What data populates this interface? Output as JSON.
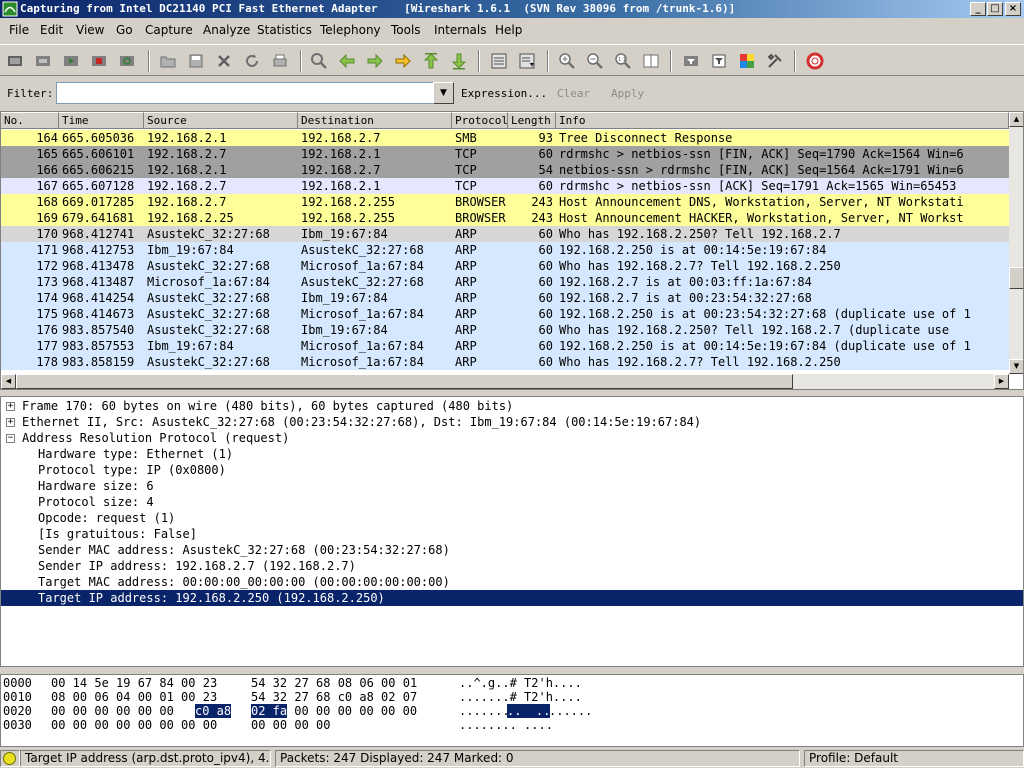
{
  "window": {
    "title": "Capturing from Intel DC21140 PCI Fast Ethernet Adapter    [Wireshark 1.6.1  (SVN Rev 38096 from /trunk-1.6)]",
    "minimize": "_",
    "maximize": "□",
    "close": "×"
  },
  "menu": [
    "File",
    "Edit",
    "View",
    "Go",
    "Capture",
    "Analyze",
    "Statistics",
    "Telephony",
    "Tools",
    "Internals",
    "Help"
  ],
  "filter": {
    "label": "Filter:",
    "value": "",
    "expression": "Expression...",
    "clear": "Clear",
    "apply": "Apply"
  },
  "columns": [
    "No.",
    "Time",
    "Source",
    "Destination",
    "Protocol",
    "Length",
    "Info"
  ],
  "packets": [
    {
      "no": "164",
      "time": "665.605036",
      "src": "192.168.2.1",
      "dst": "192.168.2.7",
      "proto": "SMB",
      "len": "93",
      "info": "Tree Disconnect Response",
      "bg": "#ffff99",
      "fg": "#000000"
    },
    {
      "no": "165",
      "time": "665.606101",
      "src": "192.168.2.7",
      "dst": "192.168.2.1",
      "proto": "TCP",
      "len": "60",
      "info": "rdrmshc > netbios-ssn [FIN, ACK] Seq=1790 Ack=1564 Win=6",
      "bg": "#a0a0a0",
      "fg": "#000000"
    },
    {
      "no": "166",
      "time": "665.606215",
      "src": "192.168.2.1",
      "dst": "192.168.2.7",
      "proto": "TCP",
      "len": "54",
      "info": "netbios-ssn > rdrmshc [FIN, ACK] Seq=1564 Ack=1791 Win=6",
      "bg": "#a0a0a0",
      "fg": "#000000"
    },
    {
      "no": "167",
      "time": "665.607128",
      "src": "192.168.2.7",
      "dst": "192.168.2.1",
      "proto": "TCP",
      "len": "60",
      "info": "rdrmshc > netbios-ssn [ACK] Seq=1791 Ack=1565 Win=65453",
      "bg": "#e7e6ff",
      "fg": "#000000"
    },
    {
      "no": "168",
      "time": "669.017285",
      "src": "192.168.2.7",
      "dst": "192.168.2.255",
      "proto": "BROWSER",
      "len": "243",
      "info": "Host Announcement DNS, Workstation, Server, NT Workstati",
      "bg": "#ffff99",
      "fg": "#000000"
    },
    {
      "no": "169",
      "time": "679.641681",
      "src": "192.168.2.25",
      "dst": "192.168.2.255",
      "proto": "BROWSER",
      "len": "243",
      "info": "Host Announcement HACKER, Workstation, Server, NT Workst",
      "bg": "#ffff99",
      "fg": "#000000"
    },
    {
      "no": "170",
      "time": "968.412741",
      "src": "AsustekC_32:27:68",
      "dst": "Ibm_19:67:84",
      "proto": "ARP",
      "len": "60",
      "info": "Who has 192.168.2.250?  Tell 192.168.2.7",
      "bg": "#d6d6d6",
      "fg": "#000000"
    },
    {
      "no": "171",
      "time": "968.412753",
      "src": "Ibm_19:67:84",
      "dst": "AsustekC_32:27:68",
      "proto": "ARP",
      "len": "60",
      "info": "192.168.2.250 is at 00:14:5e:19:67:84",
      "bg": "#d6e8ff",
      "fg": "#000000"
    },
    {
      "no": "172",
      "time": "968.413478",
      "src": "AsustekC_32:27:68",
      "dst": "Microsof_1a:67:84",
      "proto": "ARP",
      "len": "60",
      "info": "Who has 192.168.2.7?  Tell 192.168.2.250",
      "bg": "#d6e8ff",
      "fg": "#000000"
    },
    {
      "no": "173",
      "time": "968.413487",
      "src": "Microsof_1a:67:84",
      "dst": "AsustekC_32:27:68",
      "proto": "ARP",
      "len": "60",
      "info": "192.168.2.7 is at 00:03:ff:1a:67:84",
      "bg": "#d6e8ff",
      "fg": "#000000"
    },
    {
      "no": "174",
      "time": "968.414254",
      "src": "AsustekC_32:27:68",
      "dst": "Ibm_19:67:84",
      "proto": "ARP",
      "len": "60",
      "info": "192.168.2.7 is at 00:23:54:32:27:68",
      "bg": "#d6e8ff",
      "fg": "#000000"
    },
    {
      "no": "175",
      "time": "968.414673",
      "src": "AsustekC_32:27:68",
      "dst": "Microsof_1a:67:84",
      "proto": "ARP",
      "len": "60",
      "info": "192.168.2.250 is at 00:23:54:32:27:68 (duplicate use of 1",
      "bg": "#d6e8ff",
      "fg": "#000000"
    },
    {
      "no": "176",
      "time": "983.857540",
      "src": "AsustekC_32:27:68",
      "dst": "Ibm_19:67:84",
      "proto": "ARP",
      "len": "60",
      "info": "Who has 192.168.2.250?  Tell 192.168.2.7 (duplicate use",
      "bg": "#d6e8ff",
      "fg": "#000000"
    },
    {
      "no": "177",
      "time": "983.857553",
      "src": "Ibm_19:67:84",
      "dst": "Microsof_1a:67:84",
      "proto": "ARP",
      "len": "60",
      "info": "192.168.2.250 is at 00:14:5e:19:67:84 (duplicate use of 1",
      "bg": "#d6e8ff",
      "fg": "#000000"
    },
    {
      "no": "178",
      "time": "983.858159",
      "src": "AsustekC_32:27:68",
      "dst": "Microsof_1a:67:84",
      "proto": "ARP",
      "len": "60",
      "info": "Who has 192.168.2.7?  Tell 192.168.2.250",
      "bg": "#d6e8ff",
      "fg": "#000000"
    }
  ],
  "details": [
    {
      "text": "Frame 170: 60 bytes on wire (480 bits), 60 bytes captured (480 bits)",
      "expander": "+",
      "level": 0
    },
    {
      "text": "Ethernet II, Src: AsustekC_32:27:68 (00:23:54:32:27:68), Dst: Ibm_19:67:84 (00:14:5e:19:67:84)",
      "expander": "+",
      "level": 0
    },
    {
      "text": "Address Resolution Protocol (request)",
      "expander": "−",
      "level": 0
    },
    {
      "text": "Hardware type: Ethernet (1)",
      "expander": "",
      "level": 1
    },
    {
      "text": "Protocol type: IP (0x0800)",
      "expander": "",
      "level": 1
    },
    {
      "text": "Hardware size: 6",
      "expander": "",
      "level": 1
    },
    {
      "text": "Protocol size: 4",
      "expander": "",
      "level": 1
    },
    {
      "text": "Opcode: request (1)",
      "expander": "",
      "level": 1
    },
    {
      "text": "[Is gratuitous: False]",
      "expander": "",
      "level": 1
    },
    {
      "text": "Sender MAC address: AsustekC_32:27:68 (00:23:54:32:27:68)",
      "expander": "",
      "level": 1
    },
    {
      "text": "Sender IP address: 192.168.2.7 (192.168.2.7)",
      "expander": "",
      "level": 1
    },
    {
      "text": "Target MAC address: 00:00:00_00:00:00 (00:00:00:00:00:00)",
      "expander": "",
      "level": 1
    },
    {
      "text": "Target IP address: 192.168.2.250 (192.168.2.250)",
      "expander": "",
      "level": 1,
      "selected": true
    }
  ],
  "bytes": [
    {
      "offset": "0000",
      "hex_a": "00 14 5e 19 67 84 00 23",
      "hex_b": "54 32 27 68 08 06 00 01",
      "ascii": "..^.g..# T2'h...."
    },
    {
      "offset": "0010",
      "hex_a": "08 00 06 04 00 01 00 23",
      "hex_b": "54 32 27 68 c0 a8 02 07",
      "ascii": ".......# T2'h...."
    },
    {
      "offset": "0020",
      "hex_a": "00 00 00 00 00 00 c0 a8",
      "hex_b": "02 fa 00 00 00 00 00 00",
      "ascii": "...........",
      "hex_a_pre": "00 00 00 00 00 00 ",
      "hex_a_hl": "c0 a8",
      "hex_b_hl": "02 fa",
      "hex_b_post": " 00 00 00 00 00 00",
      "ascii_pre": "........",
      "ascii_hl": "..  ..",
      "ascii_post": "......"
    },
    {
      "offset": "0030",
      "hex_a": "00 00 00 00 00 00 00 00",
      "hex_b": "00 00 00 00",
      "ascii": "........ ...."
    }
  ],
  "status": {
    "field": "Target IP address (arp.dst.proto_ipv4), 4...",
    "packets": "Packets: 247 Displayed: 247 Marked: 0",
    "profile": "Profile: Default"
  },
  "colors": {
    "selection": "#0a246a",
    "smb": "#ffff99",
    "arp": "#d6e8ff",
    "tcp_fin": "#a0a0a0"
  }
}
